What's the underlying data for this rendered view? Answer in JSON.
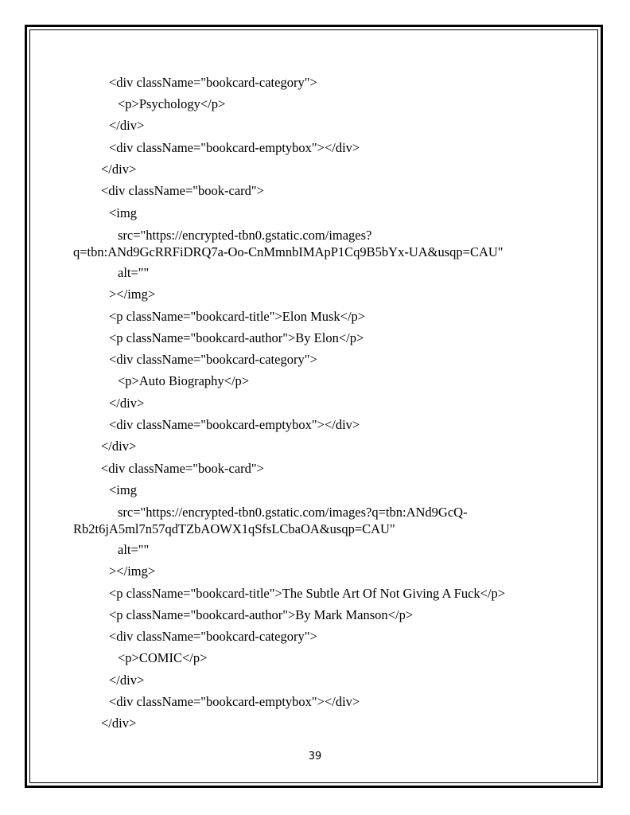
{
  "lines": [
    "<div className=\"bookcard-category\">",
    "<p>Psychology</p>",
    "</div>",
    "<div className=\"bookcard-emptybox\"></div>",
    "</div>",
    "<div className=\"book-card\">",
    "<img",
    "src=\"https://encrypted-tbn0.gstatic.com/images?",
    "q=tbn:ANd9GcRRFiDRQ7a-Oo-CnMmnbIMApP1Cq9B5bYx-UA&usqp=CAU\"",
    "alt=\"\"",
    "></img>",
    "<p className=\"bookcard-title\">Elon Musk</p>",
    "<p className=\"bookcard-author\">By Elon</p>",
    "<div className=\"bookcard-category\">",
    "<p>Auto Biography</p>",
    "</div>",
    "<div className=\"bookcard-emptybox\"></div>",
    "</div>",
    "<div className=\"book-card\">",
    "<img",
    "src=\"https://encrypted-tbn0.gstatic.com/images?q=tbn:ANd9GcQ-",
    "Rb2t6jA5ml7n57qdTZbAOWX1qSfsLCbaOA&usqp=CAU\"",
    "alt=\"\"",
    "></img>",
    "<p className=\"bookcard-title\">The Subtle Art Of Not Giving A Fuck</p>",
    "<p className=\"bookcard-author\">By Mark Manson</p>",
    "<div className=\"bookcard-category\">",
    "<p>COMIC</p>",
    "</div>",
    "<div className=\"bookcard-emptybox\"></div>",
    "</div>"
  ],
  "page_number": "39"
}
